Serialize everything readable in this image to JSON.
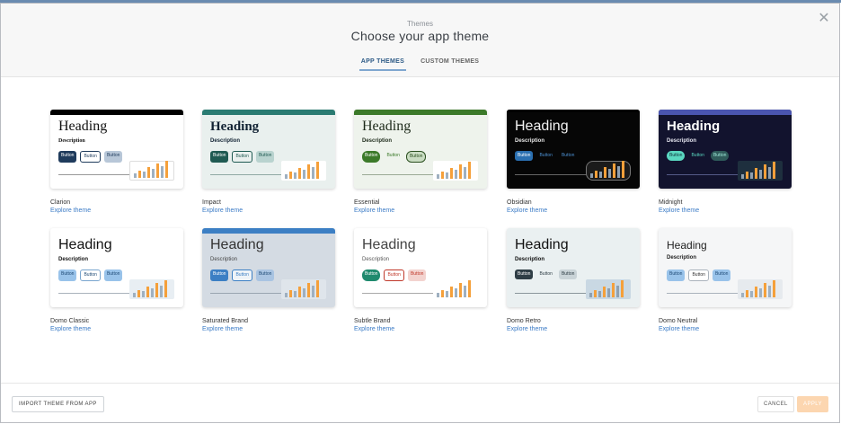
{
  "header": {
    "eyebrow": "Themes",
    "title": "Choose your app theme",
    "tabs": [
      {
        "label": "APP THEMES",
        "active": true
      },
      {
        "label": "CUSTOM THEMES",
        "active": false
      }
    ]
  },
  "preview_text": {
    "heading": "Heading",
    "description": "Description",
    "button": "Button"
  },
  "themes": [
    {
      "name": "Clarion",
      "explore": "Explore theme"
    },
    {
      "name": "Impact",
      "explore": "Explore theme"
    },
    {
      "name": "Essential",
      "explore": "Explore theme"
    },
    {
      "name": "Obsidian",
      "explore": "Explore theme"
    },
    {
      "name": "Midnight",
      "explore": "Explore theme"
    },
    {
      "name": "Domo Classic",
      "explore": "Explore theme"
    },
    {
      "name": "Saturated Brand",
      "explore": "Explore theme"
    },
    {
      "name": "Subtle Brand",
      "explore": "Explore theme"
    },
    {
      "name": "Domo Retro",
      "explore": "Explore theme"
    },
    {
      "name": "Domo Neutral",
      "explore": "Explore theme"
    }
  ],
  "footer": {
    "import_label": "IMPORT THEME FROM APP",
    "cancel_label": "CANCEL",
    "apply_label": "APPLY"
  },
  "colors": {
    "accent_link": "#3b7bc6",
    "apply_disabled": "#fcd6b0",
    "tab_active": "#2e5b87"
  }
}
